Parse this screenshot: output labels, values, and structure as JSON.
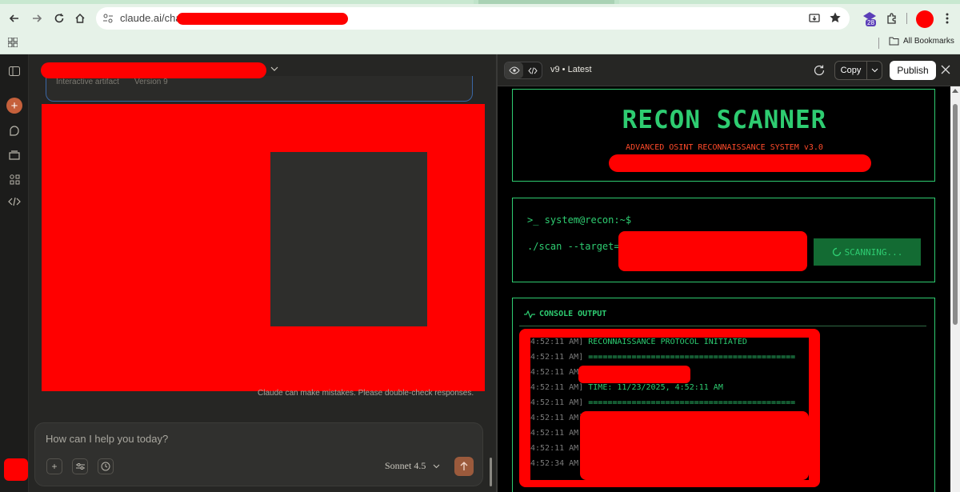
{
  "browser": {
    "url": "claude.ai/chat/",
    "extension_badge": "28",
    "bookmarks_label": "All Bookmarks"
  },
  "chat": {
    "artifact_card_left": "Interactive artifact",
    "artifact_card_right": "Version 9",
    "disclaimer": "Claude can make mistakes. Please double-check responses.",
    "composer_placeholder": "How can I help you today?",
    "model": "Sonnet 4.5"
  },
  "artifact_panel": {
    "version": "v9 • Latest",
    "copy_label": "Copy",
    "publish_label": "Publish"
  },
  "app": {
    "title": "RECON SCANNER",
    "subtitle": "ADVANCED OSINT RECONNAISSANCE SYSTEM v3.0",
    "prompt": ">_ system@recon:~$",
    "command_prefix": "./scan --target=",
    "scan_button": "SCANNING...",
    "console_title": "CONSOLE OUTPUT",
    "log": [
      {
        "ts": "4:52:11 AM]",
        "msg": "RECONNAISSANCE PROTOCOL INITIATED"
      },
      {
        "ts": "4:52:11 AM]",
        "msg": "==========================================="
      },
      {
        "ts": "4:52:11 AM]",
        "msg": ""
      },
      {
        "ts": "4:52:11 AM]",
        "msg": "TIME: 11/23/2025, 4:52:11 AM"
      },
      {
        "ts": "4:52:11 AM]",
        "msg": "==========================================="
      },
      {
        "ts": "4:52:11 AM]",
        "msg": ""
      },
      {
        "ts": "4:52:11 AM]",
        "msg": ""
      },
      {
        "ts": "4:52:11 AM]",
        "msg": ""
      },
      {
        "ts": "4:52:34 AM]",
        "msg": ""
      }
    ]
  },
  "colors": {
    "terminal_green": "#2ecc71",
    "subtitle_red": "#ff4a2a",
    "send_button": "#9b5a3c"
  }
}
